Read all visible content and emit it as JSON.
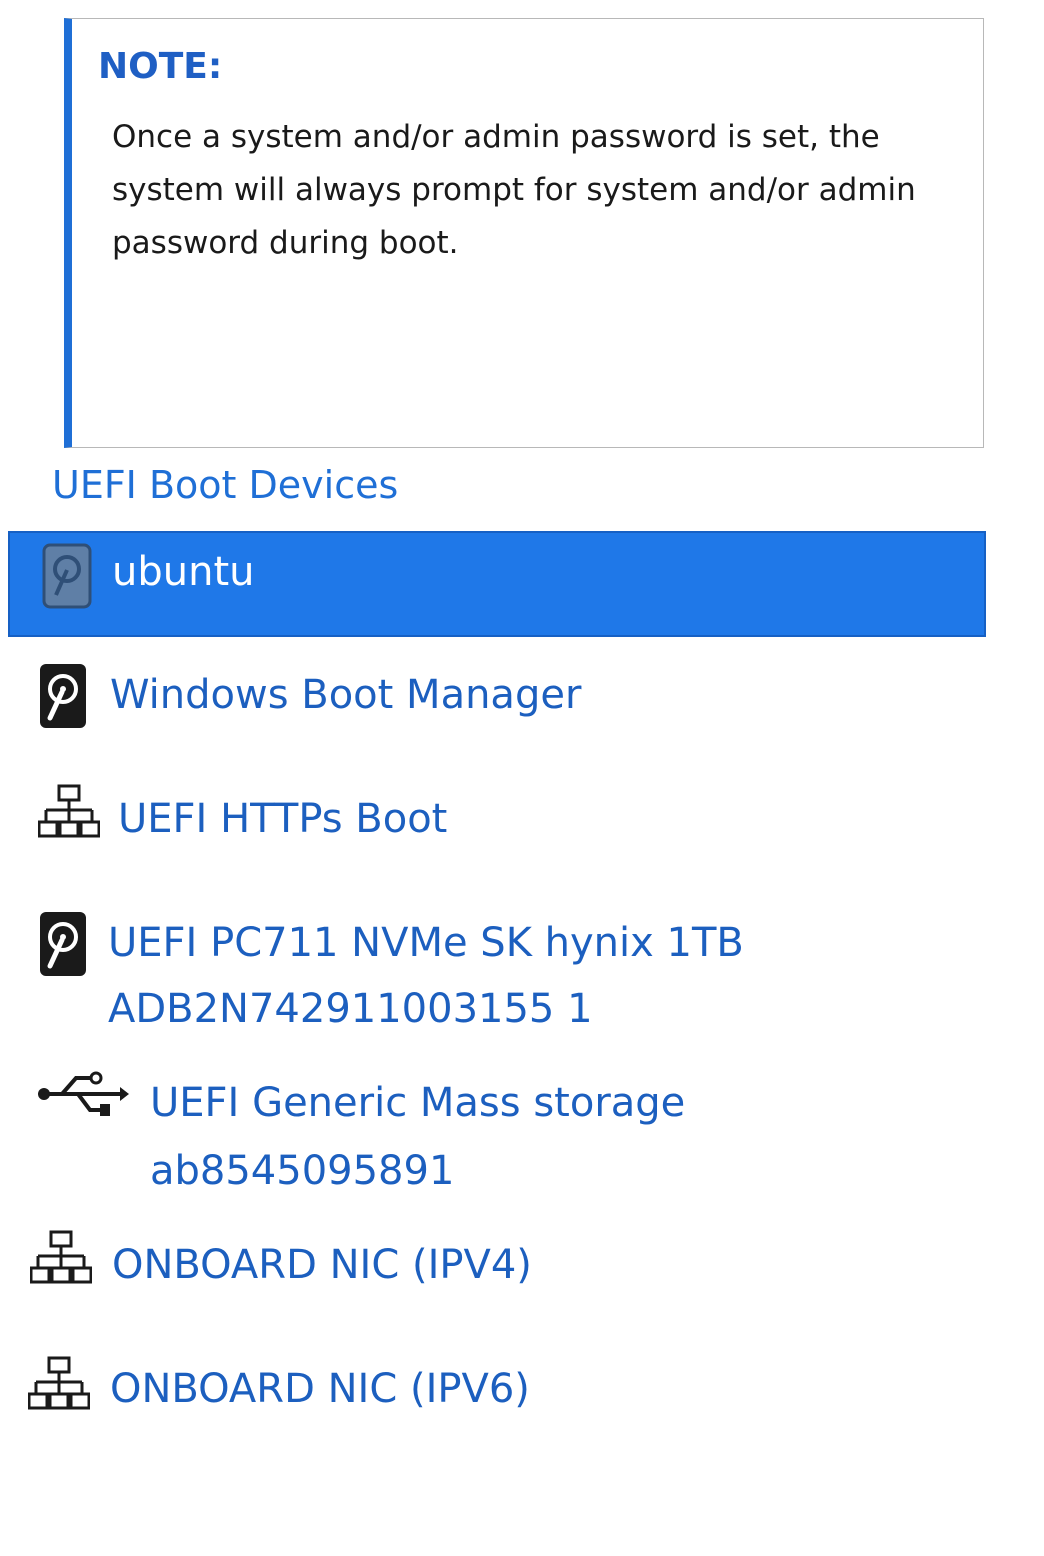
{
  "note": {
    "title": "NOTE:",
    "lines": [
      "Once a system and/or admin password is set, the",
      "system will always prompt for system and/or admin",
      "password during boot."
    ]
  },
  "boot_menu": {
    "section_title": "UEFI Boot Devices",
    "items": [
      {
        "icon": "hard-drive-icon",
        "lines": [
          "ubuntu"
        ],
        "selected": true
      },
      {
        "icon": "hard-drive-icon",
        "lines": [
          "Windows Boot Manager"
        ],
        "selected": false
      },
      {
        "icon": "network-icon",
        "lines": [
          "UEFI HTTPs Boot"
        ],
        "selected": false
      },
      {
        "icon": "hard-drive-icon",
        "lines": [
          "UEFI PC711 NVMe SK hynix 1TB",
          "ADB2N742911003155 1"
        ],
        "selected": false
      },
      {
        "icon": "usb-icon",
        "lines": [
          "UEFI Generic Mass storage",
          "ab8545095891"
        ],
        "selected": false
      },
      {
        "icon": "network-icon",
        "lines": [
          "ONBOARD NIC (IPV4)"
        ],
        "selected": false
      },
      {
        "icon": "network-icon",
        "lines": [
          "ONBOARD NIC (IPV6)"
        ],
        "selected": false
      }
    ]
  },
  "colors": {
    "accent": "#1f6fd6",
    "selection": "#1f78e8",
    "text": "#1c5fbf"
  }
}
